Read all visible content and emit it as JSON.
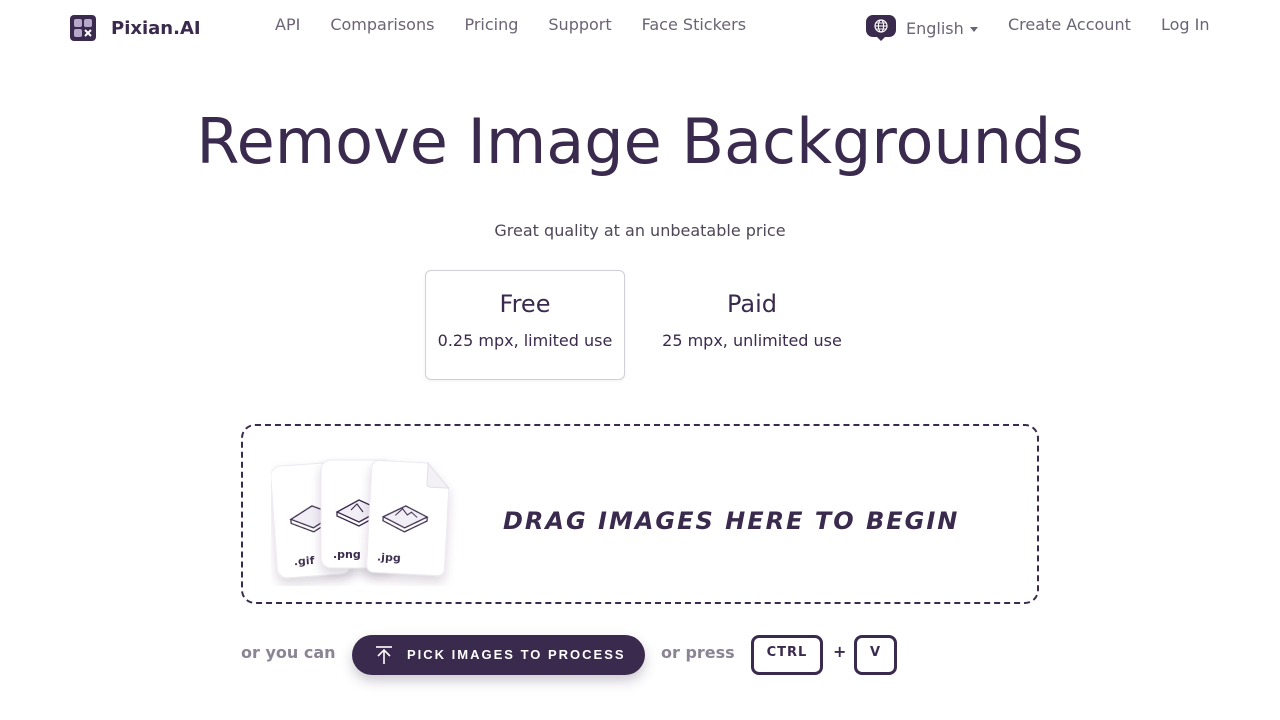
{
  "brand": {
    "name": "Pixian.AI",
    "accent": "#3a2a4d"
  },
  "nav": {
    "items": [
      {
        "label": "API"
      },
      {
        "label": "Comparisons"
      },
      {
        "label": "Pricing"
      },
      {
        "label": "Support"
      },
      {
        "label": "Face Stickers"
      }
    ]
  },
  "header": {
    "language": "English",
    "create_account": "Create Account",
    "login": "Log In"
  },
  "hero": {
    "title": "Remove Image Backgrounds",
    "subtitle": "Great quality at an unbeatable price"
  },
  "plans": [
    {
      "name": "Free",
      "desc": "0.25 mpx, limited use",
      "selected": true
    },
    {
      "name": "Paid",
      "desc": "25 mpx, unlimited use",
      "selected": false
    }
  ],
  "dropzone": {
    "text": "DRAG IMAGES HERE TO BEGIN",
    "file_types": [
      ".gif",
      ".png",
      ".jpg"
    ]
  },
  "actions": {
    "or_you_can": "or you can",
    "pick_button": "PICK IMAGES TO PROCESS",
    "or_press": "or press",
    "key_ctrl": "CTRL",
    "plus": "+",
    "key_v": "V"
  },
  "icons": {
    "logo": "pixian-logo-icon",
    "language": "globe-icon",
    "pick": "upload-arrow-icon"
  }
}
